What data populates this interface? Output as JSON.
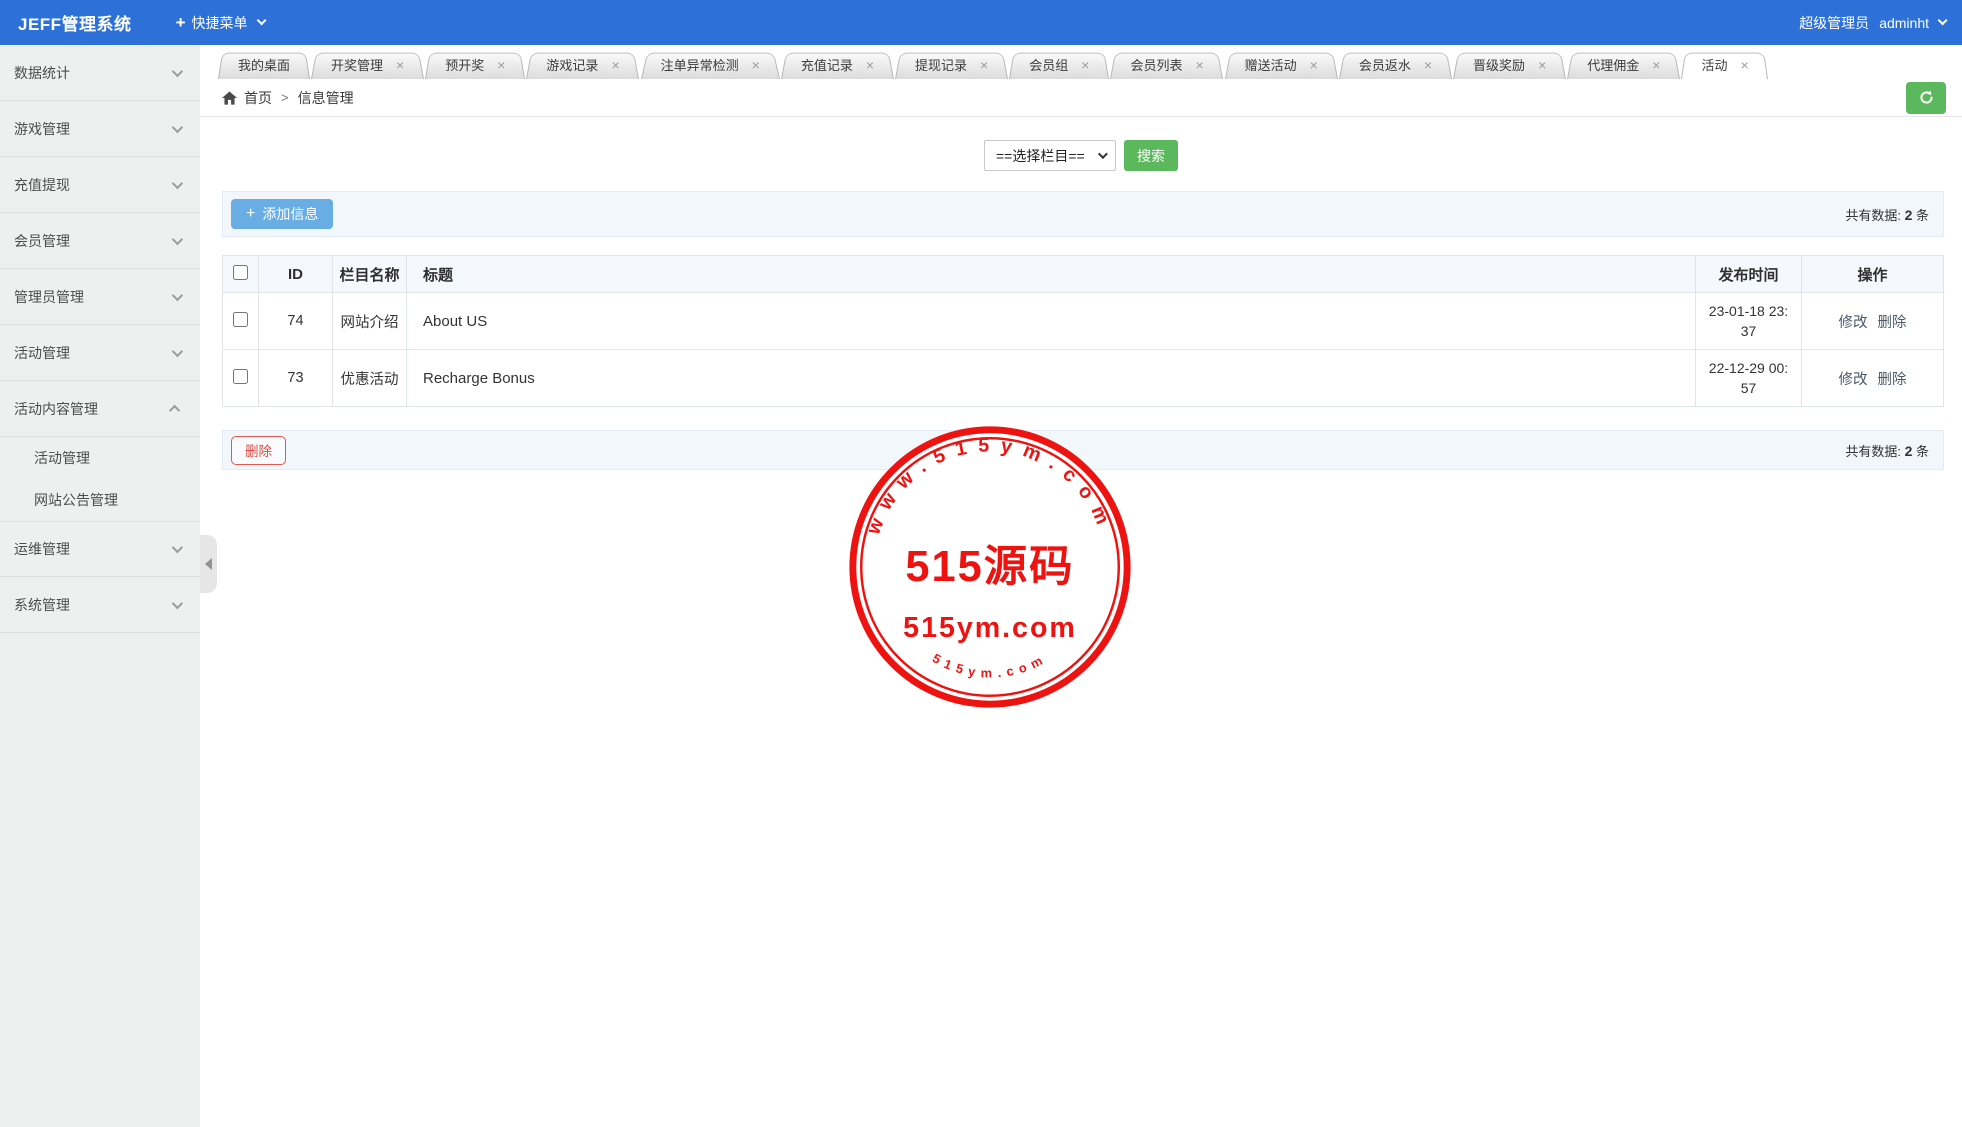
{
  "icons": {
    "plus": "+",
    "close": "×"
  },
  "header": {
    "app_title": "JEFF管理系统",
    "quick_menu_label": "快捷菜单",
    "role_label": "超级管理员",
    "username": "adminht"
  },
  "sidebar": {
    "items": [
      {
        "label": "数据统计",
        "sub": false,
        "expanded": false,
        "has_chevron": true
      },
      {
        "label": "游戏管理",
        "sub": false,
        "expanded": false,
        "has_chevron": true
      },
      {
        "label": "充值提现",
        "sub": false,
        "expanded": false,
        "has_chevron": true
      },
      {
        "label": "会员管理",
        "sub": false,
        "expanded": false,
        "has_chevron": true
      },
      {
        "label": "管理员管理",
        "sub": false,
        "expanded": false,
        "has_chevron": true
      },
      {
        "label": "活动管理",
        "sub": false,
        "expanded": false,
        "has_chevron": true
      },
      {
        "label": "活动内容管理",
        "sub": false,
        "expanded": true,
        "has_chevron": true
      },
      {
        "label": "活动管理",
        "sub": true,
        "expanded": false,
        "has_chevron": false
      },
      {
        "label": "网站公告管理",
        "sub": true,
        "expanded": false,
        "has_chevron": false
      },
      {
        "label": "运维管理",
        "sub": false,
        "expanded": false,
        "has_chevron": true
      },
      {
        "label": "系统管理",
        "sub": false,
        "expanded": false,
        "has_chevron": true
      }
    ]
  },
  "tabs": [
    {
      "label": "我的桌面",
      "closable": false,
      "active": false
    },
    {
      "label": "开奖管理",
      "closable": true,
      "active": false
    },
    {
      "label": "预开奖",
      "closable": true,
      "active": false
    },
    {
      "label": "游戏记录",
      "closable": true,
      "active": false
    },
    {
      "label": "注单异常检测",
      "closable": true,
      "active": false
    },
    {
      "label": "充值记录",
      "closable": true,
      "active": false
    },
    {
      "label": "提现记录",
      "closable": true,
      "active": false
    },
    {
      "label": "会员组",
      "closable": true,
      "active": false
    },
    {
      "label": "会员列表",
      "closable": true,
      "active": false
    },
    {
      "label": "赠送活动",
      "closable": true,
      "active": false
    },
    {
      "label": "会员返水",
      "closable": true,
      "active": false
    },
    {
      "label": "晋级奖励",
      "closable": true,
      "active": false
    },
    {
      "label": "代理佣金",
      "closable": true,
      "active": false
    },
    {
      "label": "活动",
      "closable": true,
      "active": true
    }
  ],
  "breadcrumb": {
    "home": "首页",
    "separator": ">",
    "current": "信息管理"
  },
  "filter": {
    "select_value": "==选择栏目==",
    "search_button": "搜索"
  },
  "toolbar": {
    "add_button": "添加信息",
    "count_prefix": "共有数据: ",
    "count_value": "2",
    "count_suffix": " 条"
  },
  "table": {
    "headers": [
      "ID",
      "栏目名称",
      "标题",
      "发布时间",
      "操作"
    ],
    "rows": [
      {
        "id": "74",
        "category": "网站介绍",
        "title": "About US",
        "time": "23-01-18 23:37",
        "edit": "修改",
        "delete": "删除"
      },
      {
        "id": "73",
        "category": "优惠活动",
        "title": "Recharge Bonus",
        "time": "22-12-29 00:57",
        "edit": "修改",
        "delete": "删除"
      }
    ]
  },
  "footer_bar": {
    "delete_button": "删除",
    "count_prefix": "共有数据: ",
    "count_value": "2",
    "count_suffix": " 条"
  },
  "watermark": {
    "color": "#ed1310",
    "arc_top": "www.515ym.com",
    "center_line1": "515源码",
    "center_line2": "515ym.com",
    "arc_bottom": "515ym.com"
  }
}
